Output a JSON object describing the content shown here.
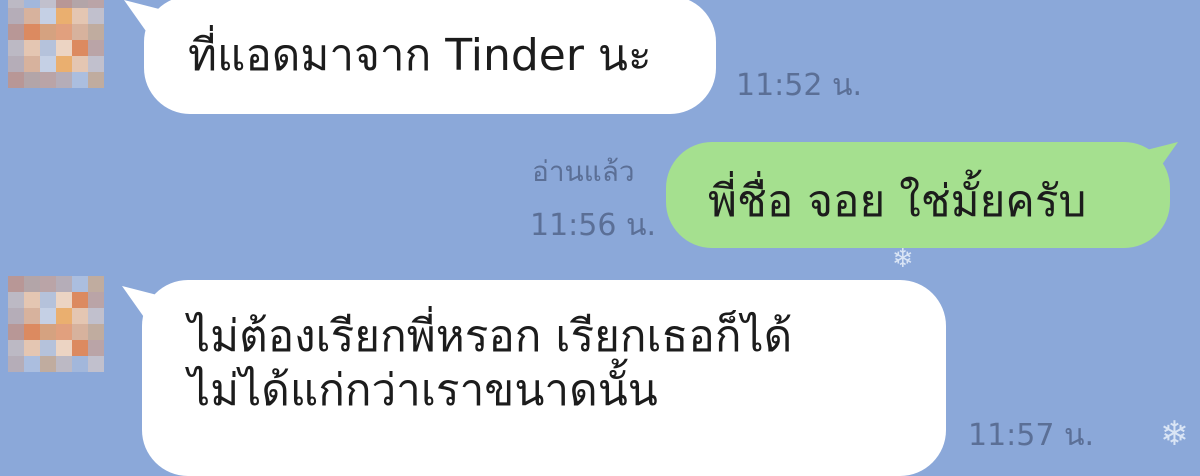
{
  "messages": [
    {
      "side": "incoming",
      "text": "ที่แอดมาจาก Tinder นะ",
      "time": "11:52 น."
    },
    {
      "side": "outgoing",
      "text": "พี่ชื่อ จอย ใช่มั้ยครับ",
      "time": "11:56 น.",
      "read": "อ่านแล้ว"
    },
    {
      "side": "incoming",
      "lines": [
        "ไม่ต้องเรียกพี่หรอก เรียกเธอก็ได้",
        "ไม่ได้แก่กว่าเราขนาดนั้น"
      ],
      "time": "11:57 น."
    }
  ],
  "colors": {
    "background": "#8ba8d9",
    "incoming_bubble": "#ffffff",
    "outgoing_bubble": "#a5e08f",
    "meta_text": "#5b6f96"
  },
  "icons": {
    "avatar": "pixelated-avatar",
    "decoration": "snowflake-icon"
  }
}
